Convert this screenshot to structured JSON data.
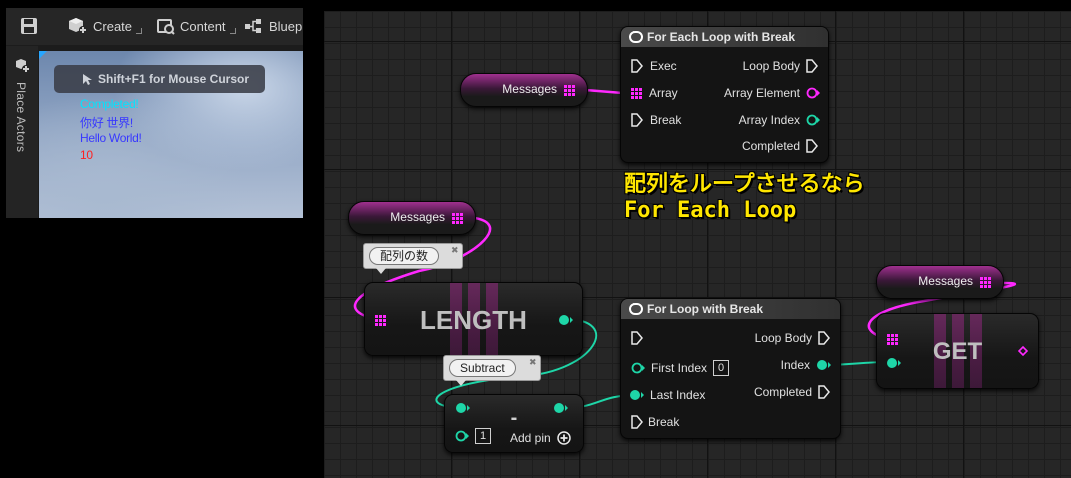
{
  "toolbar": {
    "create_label": "Create",
    "content_label": "Content",
    "blueprint_label": "Bluep"
  },
  "place_actors": {
    "label": "Place Actors"
  },
  "viewport": {
    "cursor_hint": "Shift+F1 for Mouse Cursor",
    "log_lines": [
      {
        "text": "Completed!",
        "color": "#00e5ff"
      },
      {
        "text": "你好 世界!",
        "color": "#3838ff"
      },
      {
        "text": "Hello World!",
        "color": "#3838ff"
      },
      {
        "text": "10",
        "color": "#ff2020"
      }
    ]
  },
  "colors": {
    "array_pin": "#ff28ff",
    "int_pin": "#1ed6a8",
    "exec_pin": "#e8e8e8",
    "annotation": "#ffe600"
  },
  "graph": {
    "messages_label": "Messages",
    "for_each": {
      "title": "For Each Loop with Break",
      "exec": "Exec",
      "array": "Array",
      "break": "Break",
      "loop_body": "Loop Body",
      "array_element": "Array Element",
      "array_index": "Array Index",
      "completed": "Completed"
    },
    "annotation": {
      "line1": "配列をループさせるなら",
      "line2": "For Each Loop"
    },
    "length_node": {
      "title": "LENGTH",
      "comment": "配列の数"
    },
    "subtract_node": {
      "symbol": "-",
      "comment": "Subtract",
      "default_value": "1",
      "add_pin": "Add pin"
    },
    "for_loop": {
      "title": "For Loop with Break",
      "first_index": "First Index",
      "first_index_value": "0",
      "last_index": "Last Index",
      "break": "Break",
      "loop_body": "Loop Body",
      "index": "Index",
      "completed": "Completed"
    },
    "get_node": {
      "title": "GET"
    }
  }
}
